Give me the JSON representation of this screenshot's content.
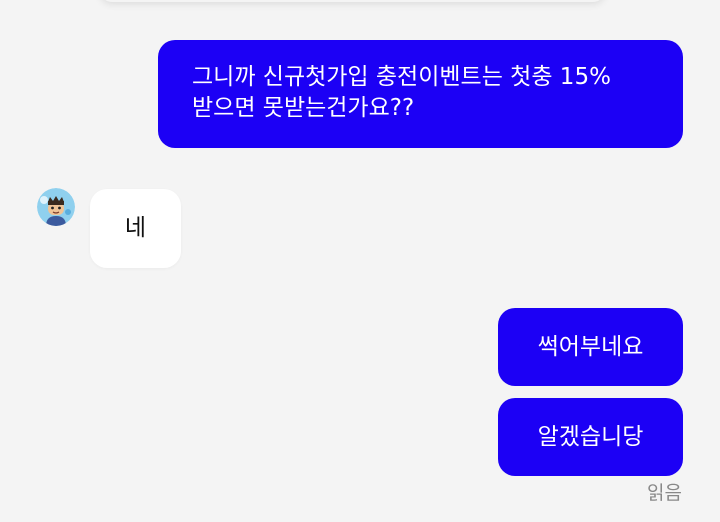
{
  "messages": {
    "outgoing_1": {
      "lines": [
        "그니까 신규첫가입 충전이벤트는 첫충 15%",
        "받으면 못받는건가요??"
      ]
    },
    "incoming_1": {
      "text": "네"
    },
    "outgoing_2": {
      "text": "썩어부네요"
    },
    "outgoing_3": {
      "text": "알겠습니당"
    }
  },
  "read_status": "읽음",
  "avatar": {
    "icon": "cartoon-character-avatar-icon"
  },
  "colors": {
    "outgoing_bubble": "#1c00f5",
    "incoming_bubble": "#ffffff",
    "background": "#f4f4f4",
    "read_status_text": "#888888"
  }
}
